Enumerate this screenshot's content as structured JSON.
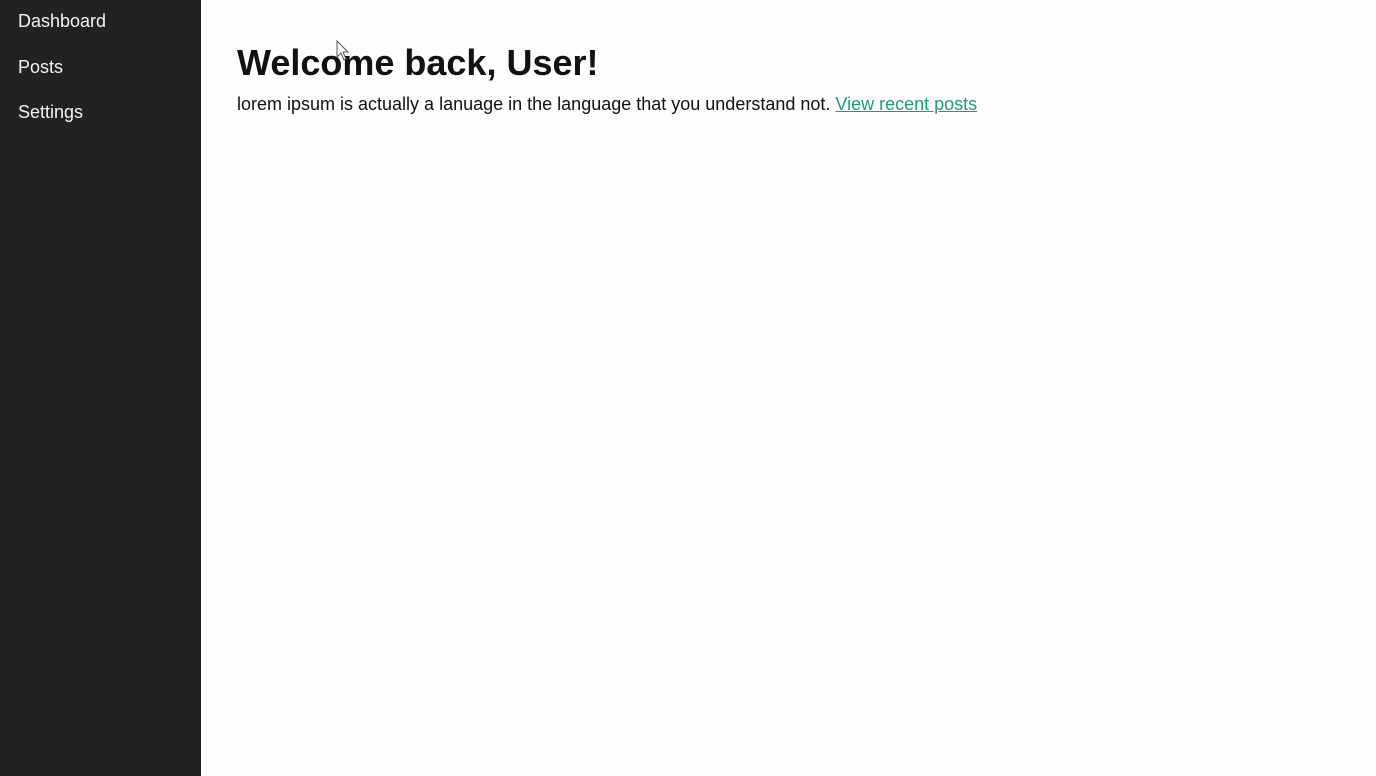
{
  "sidebar": {
    "items": [
      {
        "label": "Dashboard"
      },
      {
        "label": "Posts"
      },
      {
        "label": "Settings"
      }
    ]
  },
  "main": {
    "title": "Welcome back, User!",
    "intro_text": "lorem ipsum is actually a lanuage in the language that you understand not. ",
    "link_label": "View recent posts"
  },
  "colors": {
    "sidebar_bg": "#222222",
    "main_bg": "#fdfdfd",
    "link": "#1a9e7a",
    "text": "#111111"
  },
  "icons": {
    "cursor": "mouse-pointer-icon"
  }
}
